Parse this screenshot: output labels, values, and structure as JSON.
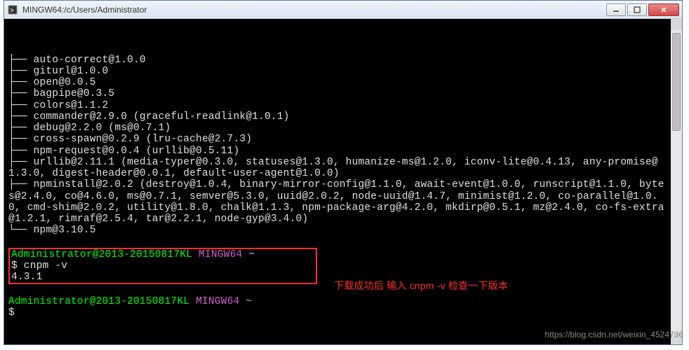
{
  "window": {
    "title": "MINGW64:/c/Users/Administrator"
  },
  "terminal": {
    "lines": [
      "├── auto-correct@1.0.0",
      "├── giturl@1.0.0",
      "├── open@0.0.5",
      "├── bagpipe@0.3.5",
      "├── colors@1.1.2",
      "├── commander@2.9.0 (graceful-readlink@1.0.1)",
      "├── debug@2.2.0 (ms@0.7.1)",
      "├── cross-spawn@0.2.9 (lru-cache@2.7.3)",
      "├── npm-request@0.0.4 (urllib@0.5.11)",
      "├── urllib@2.11.1 (media-typer@0.3.0, statuses@1.3.0, humanize-ms@1.2.0, iconv-lite@0.4.13, any-promise@1.3.0, digest-header@0.0.1, default-user-agent@1.0.0)",
      "├── npminstall@2.0.2 (destroy@1.0.4, binary-mirror-config@1.1.0, await-event@1.0.0, runscript@1.1.0, bytes@2.4.0, co@4.6.0, ms@0.7.1, semver@5.3.0, uuid@2.0.2, node-uuid@1.4.7, minimist@1.2.0, co-parallel@1.0.0, cmd-shim@2.0.2, utility@1.8.0, chalk@1.1.3, npm-package-arg@4.2.0, mkdirp@0.5.1, mz@2.4.0, co-fs-extra@1.2.1, rimraf@2.5.4, tar@2.2.1, node-gyp@3.4.0)",
      "└── npm@3.10.5"
    ],
    "prompt1_user": "Administrator@2013-20150817KL",
    "prompt1_env": "MINGW64",
    "prompt1_path": "~",
    "cmd1": "$ cnpm -v",
    "out1": "4.3.1",
    "prompt2_user": "Administrator@2013-20150817KL",
    "prompt2_env": "MINGW64",
    "prompt2_path": "~",
    "cmd2": "$"
  },
  "annotation": {
    "text": "下载成功后 输入 cnpm -v 检查一下版本"
  },
  "watermark": "https://blog.csdn.net/weixin_4524736"
}
